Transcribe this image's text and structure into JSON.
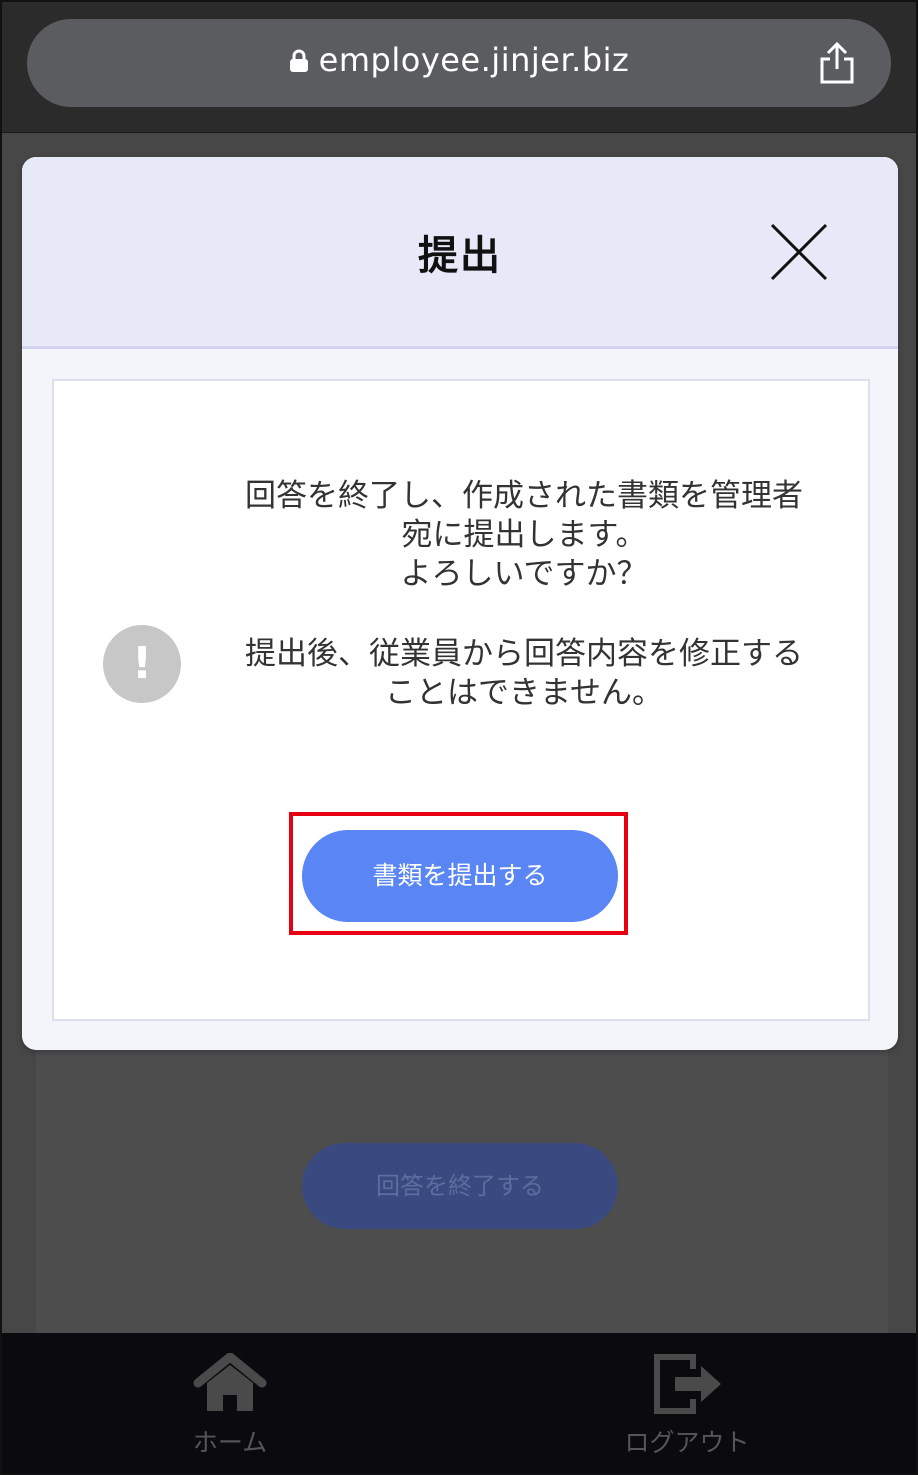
{
  "browser": {
    "url": "employee.jinjer.biz"
  },
  "background": {
    "button_label": "回答を終了する"
  },
  "modal": {
    "title": "提出",
    "message_lines": [
      "回答を終了し、作成された書類を管理者",
      "宛に提出します。",
      "よろしいですか？"
    ],
    "warning_lines": [
      "提出後、従業員から回答内容を修正する",
      "ことはできません。"
    ],
    "submit_label": "書類を提出する",
    "highlight_color": "#e60012",
    "button_color": "#5a86f5"
  },
  "tabbar": {
    "home_label": "ホーム",
    "logout_label": "ログアウト"
  }
}
